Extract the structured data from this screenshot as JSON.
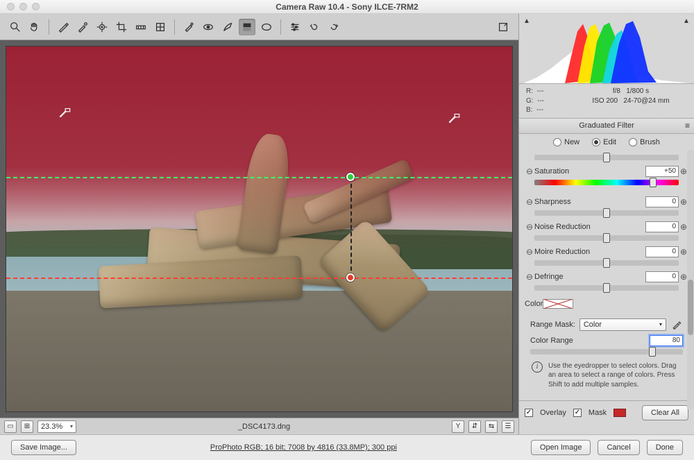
{
  "title": "Camera Raw 10.4  -  Sony ILCE-7RM2",
  "toolbar_icons": [
    "zoom",
    "hand",
    "white-balance",
    "color-sampler",
    "target-adjust",
    "crop",
    "straighten",
    "transform",
    "perspective",
    "spot-removal",
    "red-eye",
    "adjustment-brush",
    "graduated-filter",
    "radial-filter",
    "preferences",
    "rotate-ccw",
    "rotate-cw"
  ],
  "preview": {
    "filename": "_DSC4173.dng",
    "zoom": "23.3%"
  },
  "meta": {
    "R": "---",
    "G": "---",
    "B": "---",
    "aperture": "f/8",
    "shutter": "1/800 s",
    "iso": "ISO 200",
    "lens": "24-70@24 mm"
  },
  "panel": {
    "title": "Graduated Filter",
    "modes": {
      "new": "New",
      "edit": "Edit",
      "brush": "Brush",
      "selected": "edit"
    },
    "sliders": {
      "saturation": {
        "label": "Saturation",
        "value": "+50",
        "pos": 82
      },
      "sharpness": {
        "label": "Sharpness",
        "value": "0",
        "pos": 50
      },
      "noise": {
        "label": "Noise Reduction",
        "value": "0",
        "pos": 50
      },
      "moire": {
        "label": "Moire Reduction",
        "value": "0",
        "pos": 50
      },
      "defringe": {
        "label": "Defringe",
        "value": "0",
        "pos": 50
      }
    },
    "color_label": "Color",
    "range_mask": {
      "label": "Range Mask:",
      "value": "Color"
    },
    "color_range": {
      "label": "Color Range",
      "value": "80",
      "pos": 80
    },
    "hint": "Use the eyedropper to select colors. Drag an area to select a range of colors. Press Shift to add multiple samples.",
    "overlay": {
      "label": "Overlay",
      "checked": true
    },
    "mask": {
      "label": "Mask",
      "checked": true
    },
    "clear": "Clear All"
  },
  "footer": {
    "save": "Save Image...",
    "workflow": "ProPhoto RGB; 16 bit; 7008 by 4816 (33.8MP); 300 ppi",
    "open": "Open Image",
    "cancel": "Cancel",
    "done": "Done"
  }
}
